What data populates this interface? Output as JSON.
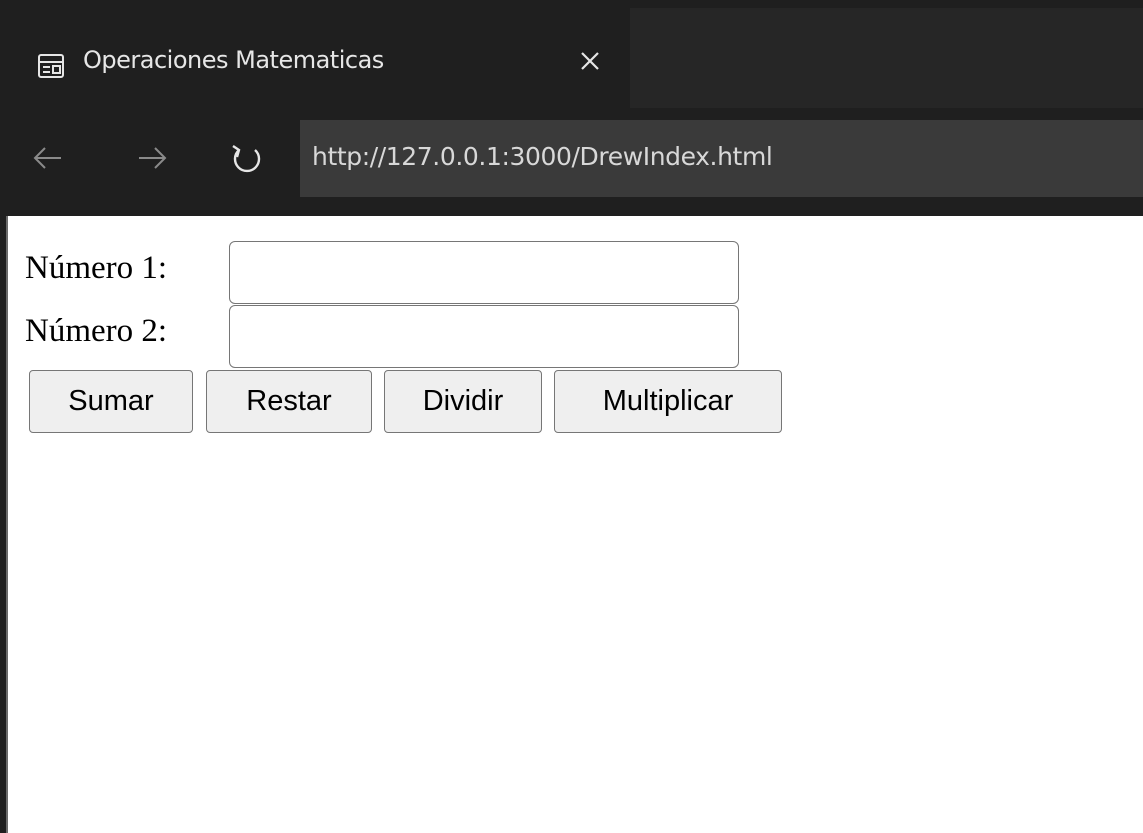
{
  "browser": {
    "tab": {
      "title": "Operaciones Matematicas",
      "icon": "page-icon",
      "close_icon": "close-icon"
    },
    "toolbar": {
      "back_icon": "arrow-left-icon",
      "forward_icon": "arrow-right-icon",
      "reload_icon": "reload-icon",
      "url": "http://127.0.0.1:3000/DrewIndex.html"
    }
  },
  "form": {
    "number1_label": "Número 1:",
    "number1_value": "",
    "number2_label": "Número 2:",
    "number2_value": "",
    "buttons": {
      "add": "Sumar",
      "subtract": "Restar",
      "divide": "Dividir",
      "multiply": "Multiplicar"
    }
  },
  "colors": {
    "chrome_bg": "#1f1f1f",
    "url_bar_bg": "#3a3a3a",
    "button_bg": "#efefef",
    "border": "#767676"
  }
}
